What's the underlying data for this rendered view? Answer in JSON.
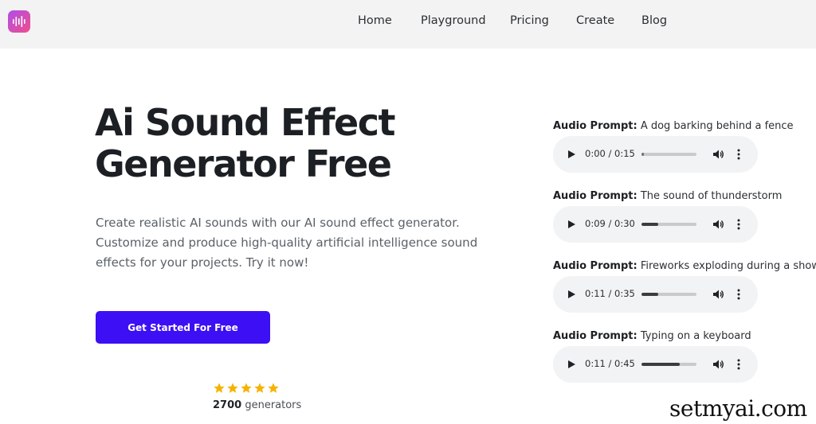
{
  "nav": {
    "logo_icon": "sound-wave-icon",
    "links": [
      "Home",
      "Playground",
      "Pricing",
      "Create",
      "Blog"
    ]
  },
  "hero": {
    "title_line1": "Ai Sound Effect",
    "title_line2": "Generator Free",
    "description": "Create realistic AI sounds with our AI sound effect generator. Customize and produce high-quality artificial intelligence sound effects for your projects. Try it now!",
    "cta_label": "Get Started For Free"
  },
  "rating": {
    "stars": 5,
    "count": "2700",
    "suffix": "generators"
  },
  "prompts": [
    {
      "label": "Audio Prompt:",
      "text": "A dog barking behind a fence",
      "time": "0:00 / 0:15",
      "progress": 0.0
    },
    {
      "label": "Audio Prompt:",
      "text": "The sound of thunderstorm",
      "time": "0:09 / 0:30",
      "progress": 0.3
    },
    {
      "label": "Audio Prompt:",
      "text": "Fireworks exploding during a show",
      "time": "0:11 / 0:35",
      "progress": 0.31
    },
    {
      "label": "Audio Prompt:",
      "text": "Typing on a keyboard",
      "time": "0:11 / 0:45",
      "progress": 0.7
    }
  ],
  "watermark": "setmyai.com",
  "colors": {
    "accent": "#3d0ff5",
    "star": "#f5b301",
    "logo_gradient_start": "#b04ee8",
    "logo_gradient_end": "#f04d8c"
  }
}
